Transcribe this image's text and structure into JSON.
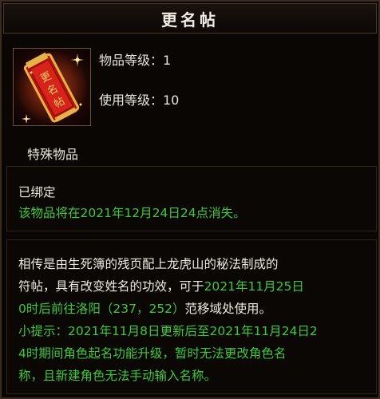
{
  "title": "更名帖",
  "item": {
    "icon": "rename-card-icon",
    "icon_text": "更名帖",
    "item_level_label": "物品等级：1",
    "use_level_label": "使用等级：10",
    "category": "特殊物品"
  },
  "binding": {
    "bound": "已绑定",
    "expiry": "该物品将在2021年12月24日24点消失。"
  },
  "description": {
    "line1": "相传是由生死簿的残页配上龙虎山的秘法制成的",
    "line2_white": "符帖，具有改变姓名的功效，可于",
    "line2_green": "2021年11月25日",
    "line3_green_a": "0时后前往",
    "line3_green_b": "洛阳（237，252）",
    "line3_white": "范移域处使用。",
    "tip1": "小提示：2021年11月8日更新后至2021年11月24日2",
    "tip2": "4时期间角色起名功能升级，暂时无法更改角色名",
    "tip3": "称，且新建角色无法手动输入名称。"
  },
  "colors": {
    "white_text": "#ede8e0",
    "green_text": "#3fc83b",
    "frame": "#3a2c1e"
  }
}
